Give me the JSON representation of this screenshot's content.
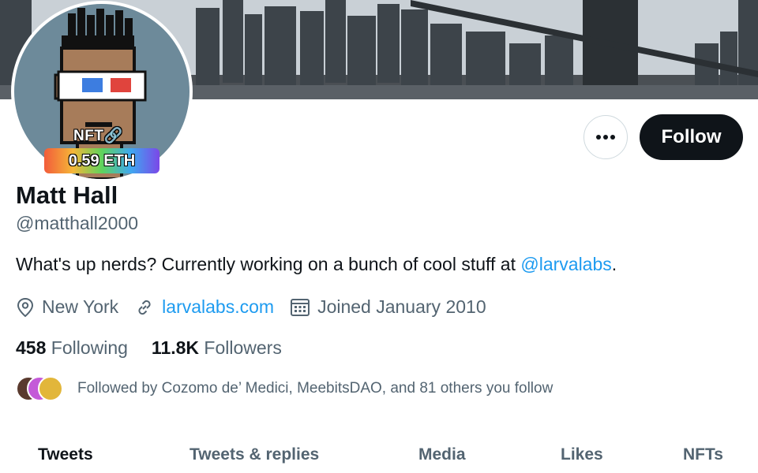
{
  "profile": {
    "name": "Matt Hall",
    "handle": "@matthall2000",
    "bio_text": "What's up nerds? Currently working on a bunch of cool stuff at ",
    "bio_mention": "@larvalabs",
    "bio_suffix": "."
  },
  "avatar": {
    "nft_label": "NFT",
    "price_badge": "0.59 ETH"
  },
  "actions": {
    "follow_label": "Follow",
    "more_icon": "more-icon"
  },
  "meta": {
    "location": "New York",
    "website": "larvalabs.com",
    "joined": "Joined January 2010"
  },
  "stats": {
    "following_count": "458",
    "following_label": "Following",
    "followers_count": "11.8K",
    "followers_label": "Followers"
  },
  "followed_by": {
    "text": "Followed by Cozomo de’ Medici, MeebitsDAO, and 81 others you follow"
  },
  "tabs": [
    {
      "label": "Tweets"
    },
    {
      "label": "Tweets & replies"
    },
    {
      "label": "Media"
    },
    {
      "label": "Likes"
    },
    {
      "label": "NFTs"
    }
  ],
  "colors": {
    "accent": "#1d9bf0",
    "text_primary": "#0f1419",
    "text_secondary": "#536471"
  }
}
